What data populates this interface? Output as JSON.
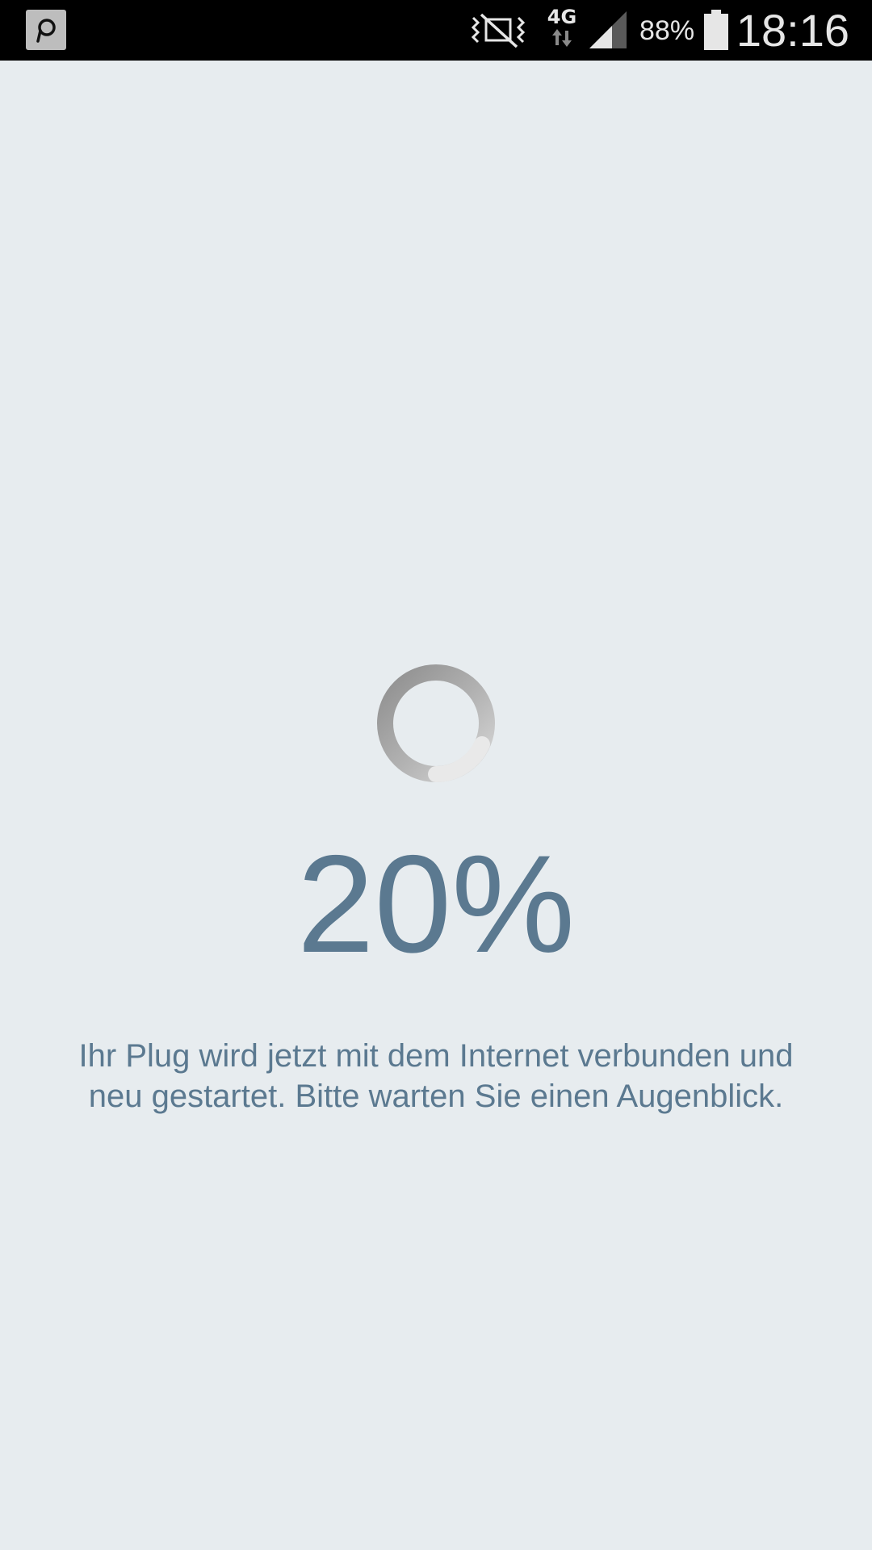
{
  "status_bar": {
    "app_icon": "plug-app-icon",
    "mute_icon": "vibrate-mute-icon",
    "network_type": "4G",
    "data_icon": "data-transfer-arrows-icon",
    "signal_icon": "signal-strength-icon",
    "battery_percent": "88%",
    "battery_icon": "battery-icon",
    "time": "18:16"
  },
  "main": {
    "spinner_icon": "loading-spinner-icon",
    "progress_text": "20%",
    "progress_value": 0.2,
    "message_line1": "Ihr Plug wird jetzt mit dem Internet verbunden und",
    "message_line2": "neu gestartet. Bitte warten Sie einen Augenblick."
  },
  "colors": {
    "background": "#e7ecef",
    "text": "#5b7990",
    "status_bar": "#000000"
  }
}
